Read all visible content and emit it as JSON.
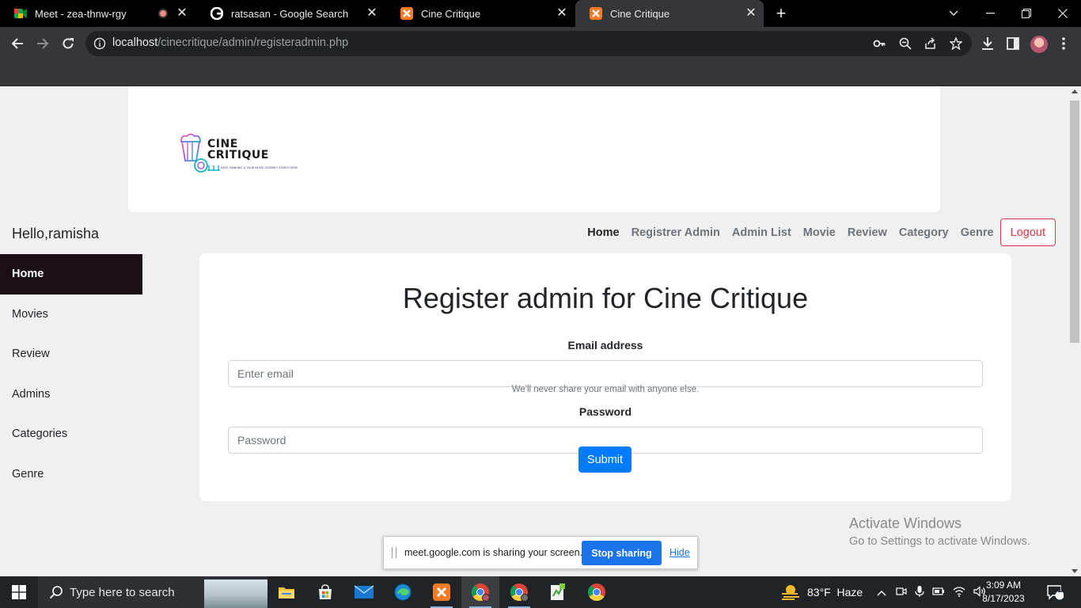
{
  "browser": {
    "tabs": [
      {
        "title": "Meet - zea-thnw-rgy",
        "icon": "google-meet-icon",
        "active": false,
        "recording": true
      },
      {
        "title": "ratsasan - Google Search",
        "icon": "google-icon",
        "active": false
      },
      {
        "title": "Cine Critique",
        "icon": "xampp-icon",
        "active": false
      },
      {
        "title": "Cine Critique",
        "icon": "xampp-icon",
        "active": true
      }
    ],
    "url_host": "localhost",
    "url_path": "/cinecritique/admin/registeradmin.php"
  },
  "page": {
    "logo": {
      "line1": "CINE",
      "line2": "CRITIQUE",
      "tagline": "RATE, RANKING, & YOUR MOVIE JOURNEY STARTS HERE"
    },
    "greeting": "Hello,ramisha",
    "nav": {
      "items": [
        "Home",
        "Registrer Admin",
        "Admin List",
        "Movie",
        "Review",
        "Category",
        "Genre"
      ],
      "active": "Home",
      "logout": "Logout"
    },
    "sidebar": {
      "items": [
        "Home",
        "Movies",
        "Review",
        "Admins",
        "Categories",
        "Genre"
      ],
      "active": "Home"
    },
    "form": {
      "title": "Register admin for Cine Critique",
      "email_label": "Email address",
      "email_placeholder": "Enter email",
      "email_help": "We'll never share your email with anyone else.",
      "password_label": "Password",
      "password_placeholder": "Password",
      "submit": "Submit"
    },
    "watermark": {
      "line1": "Activate Windows",
      "line2": "Go to Settings to activate Windows."
    },
    "share_bar": {
      "text": "meet.google.com is sharing your screen.",
      "stop": "Stop sharing",
      "hide": "Hide"
    }
  },
  "taskbar": {
    "search_placeholder": "Type here to search",
    "weather": "83°F  Haze",
    "time": "3:09 AM",
    "date": "8/17/2023",
    "notification_count": "1",
    "colors": {
      "accent": "#007bff",
      "logout": "#dc3545",
      "sidebar_active": "#1a0f17"
    }
  }
}
